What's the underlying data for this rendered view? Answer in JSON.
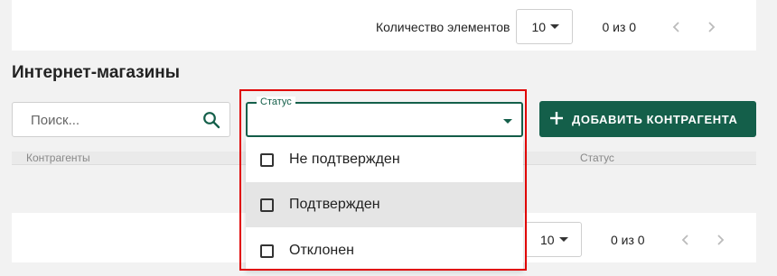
{
  "top_pager": {
    "items_label": "Количество элементов",
    "page_size": "10",
    "range": "0 из 0"
  },
  "section": {
    "title": "Интернет-магазины"
  },
  "search": {
    "placeholder": "Поиск...",
    "icon": "search-icon"
  },
  "status_filter": {
    "label": "Статус",
    "value": "",
    "options": [
      {
        "label": "Не подтвержден",
        "checked": false
      },
      {
        "label": "Подтвержден",
        "checked": false,
        "highlighted": true
      },
      {
        "label": "Отклонен",
        "checked": false
      }
    ]
  },
  "add_button": {
    "label": "ДОБАВИТЬ КОНТРАГЕНТА",
    "icon": "plus-icon"
  },
  "table": {
    "columns": [
      "Контрагенты",
      "Статус"
    ]
  },
  "bottom_pager": {
    "page_size": "10",
    "range": "0 из 0"
  },
  "colors": {
    "primary": "#145f4a",
    "highlight_frame": "#e00000",
    "background": "#f2f2f2"
  }
}
